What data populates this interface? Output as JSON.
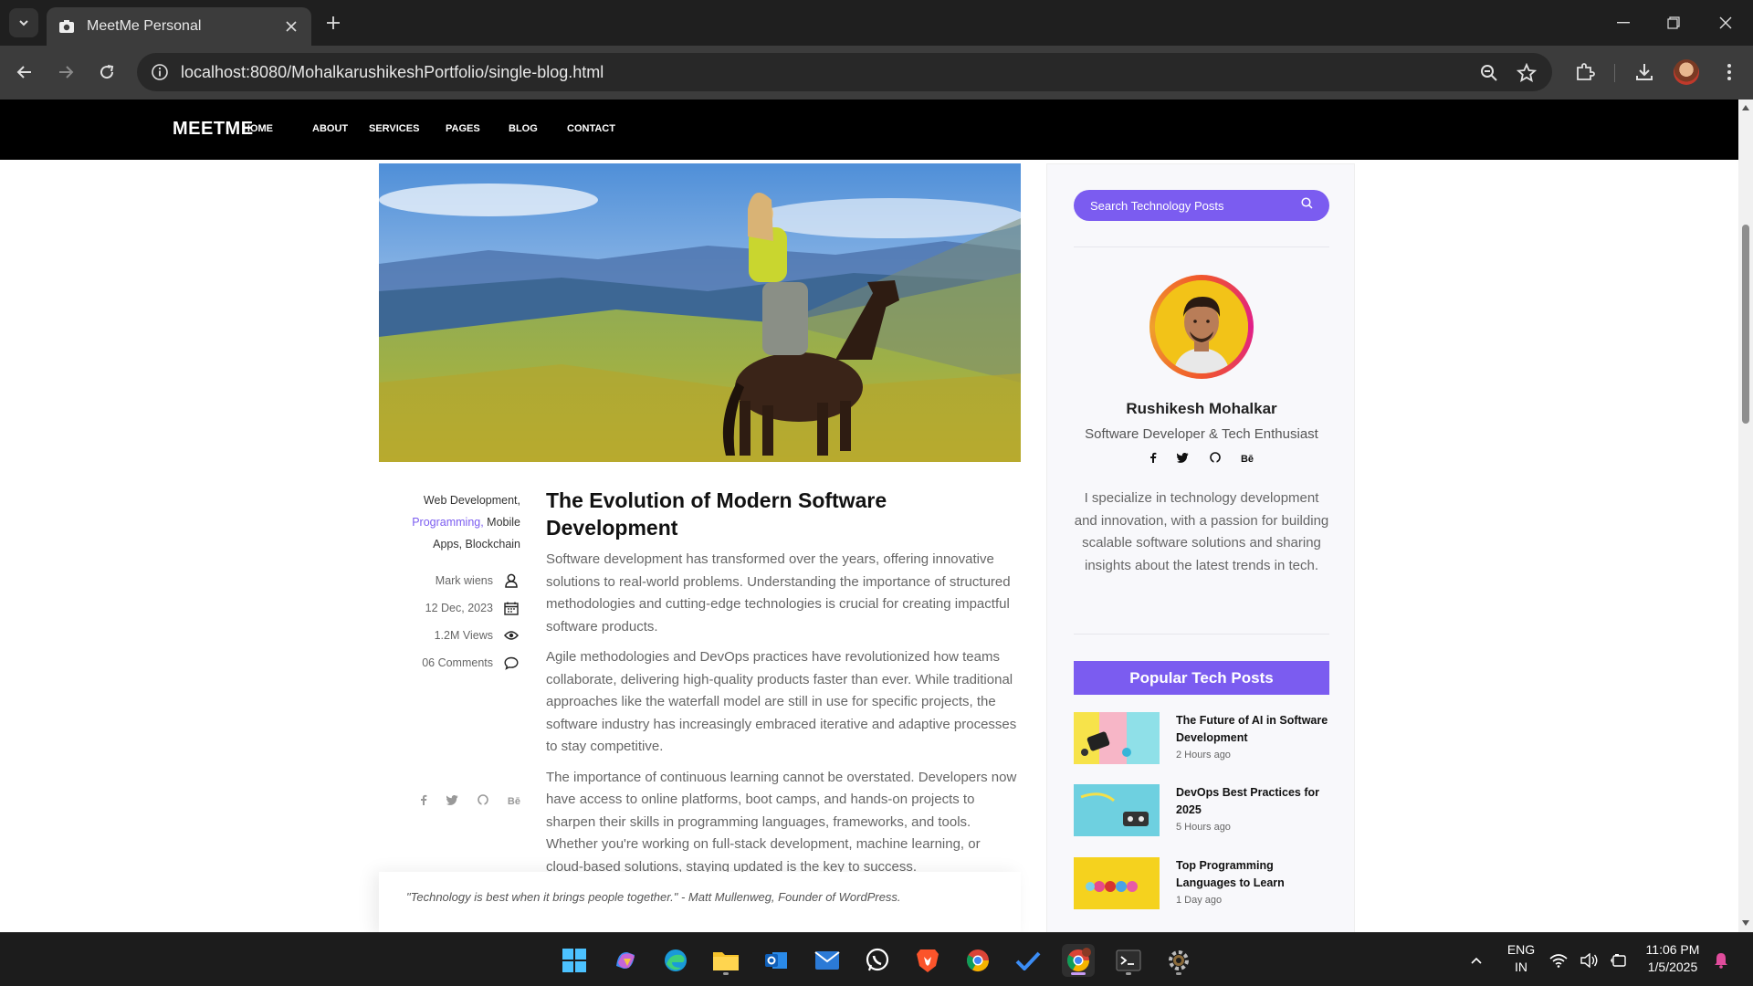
{
  "browser": {
    "tab_title": "MeetMe Personal",
    "url": "localhost:8080/MohalkarushikeshPortfolio/single-blog.html"
  },
  "site": {
    "logo": "MEETME",
    "nav": [
      "HOME",
      "ABOUT",
      "SERVICES",
      "PAGES",
      "BLOG",
      "CONTACT"
    ]
  },
  "post_meta": {
    "categories_line1": "Web Development,",
    "categories_hl": "Programming,",
    "categories_tail1": " Mobile",
    "categories_line3": "Apps, Blockchain",
    "author": "Mark wiens",
    "date": "12 Dec, 2023",
    "views": "1.2M Views",
    "comments": "06 Comments"
  },
  "article": {
    "title": "The Evolution of Modern Software Development",
    "p1": "Software development has transformed over the years, offering innovative solutions to real-world problems. Understanding the importance of structured methodologies and cutting-edge technologies is crucial for creating impactful software products.",
    "p2": "Agile methodologies and DevOps practices have revolutionized how teams collaborate, delivering high-quality products faster than ever. While traditional approaches like the waterfall model are still in use for specific projects, the software industry has increasingly embraced iterative and adaptive processes to stay competitive.",
    "p3": "The importance of continuous learning cannot be overstated. Developers now have access to online platforms, boot camps, and hands-on projects to sharpen their skills in programming languages, frameworks, and tools. Whether you're working on full-stack development, machine learning, or cloud-based solutions, staying updated is the key to success.",
    "quote": "\"Technology is best when it brings people together.\" - Matt Mullenweg, Founder of WordPress."
  },
  "sidebar": {
    "search_placeholder": "Search Technology Posts",
    "author_name": "Rushikesh Mohalkar",
    "author_role": "Software Developer & Tech Enthusiast",
    "author_bio": "I specialize in technology development and innovation, with a passion for building scalable software solutions and sharing insights about the latest trends in tech.",
    "popular_heading": "Popular Tech Posts",
    "posts": [
      {
        "title": "The Future of AI in Software Development",
        "time": "2 Hours ago"
      },
      {
        "title": "DevOps Best Practices for 2025",
        "time": "5 Hours ago"
      },
      {
        "title": "Top Programming Languages to Learn",
        "time": "1 Day ago"
      }
    ]
  },
  "taskbar": {
    "lang_line1": "ENG",
    "lang_line2": "IN",
    "time": "11:06 PM",
    "date": "1/5/2025"
  },
  "colors": {
    "accent": "#7b5cf0",
    "nav_bg": "#000000",
    "chrome_bg": "#1f1f1f"
  }
}
